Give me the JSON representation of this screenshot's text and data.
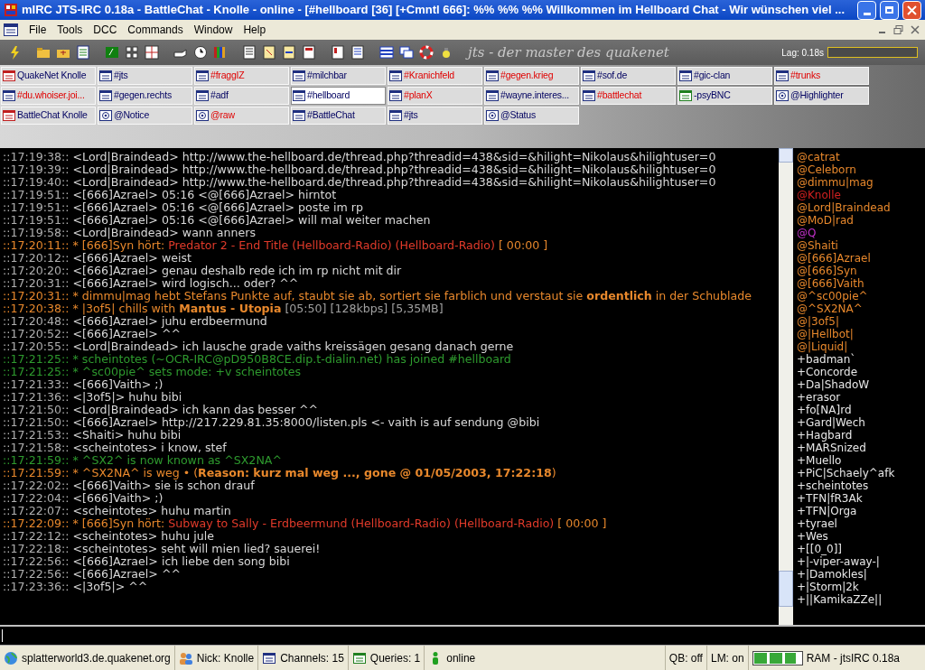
{
  "window": {
    "title": "mIRC JTS-IRC 0.18a - BattleChat - Knolle - online - [#hellboard [36] [+Cmntl 666]: %% %% %%  Willkommen im Hellboard Chat - Wir wünschen viel ..."
  },
  "menu": [
    "File",
    "Tools",
    "DCC",
    "Commands",
    "Window",
    "Help"
  ],
  "toolbar": {
    "logo": "jts - der master des quakenet",
    "lag": "Lag: 0.18s",
    "lag_meter": {
      "level": 0
    }
  },
  "switchbar": [
    [
      {
        "label": "QuakeNet Knolle",
        "kind": "status",
        "activity": false,
        "selected": false
      },
      {
        "label": "#jts",
        "kind": "channel",
        "activity": false,
        "selected": false
      },
      {
        "label": "#fraggIZ",
        "kind": "channel",
        "activity": true,
        "selected": false
      },
      {
        "label": "#milchbar",
        "kind": "channel",
        "activity": false,
        "selected": false
      },
      {
        "label": "#Kranichfeld",
        "kind": "channel",
        "activity": true,
        "selected": false
      },
      {
        "label": "#gegen.krieg",
        "kind": "channel",
        "activity": true,
        "selected": false
      },
      {
        "label": "#sof.de",
        "kind": "channel",
        "activity": false,
        "selected": false
      },
      {
        "label": "#gic-clan",
        "kind": "channel",
        "activity": false,
        "selected": false
      },
      {
        "label": "#trunks",
        "kind": "channel",
        "activity": true,
        "selected": false
      }
    ],
    [
      {
        "label": "#du.whoiser.joi...",
        "kind": "channel",
        "activity": true,
        "selected": false
      },
      {
        "label": "#gegen.rechts",
        "kind": "channel",
        "activity": false,
        "selected": false
      },
      {
        "label": "#adf",
        "kind": "channel",
        "activity": false,
        "selected": false
      },
      {
        "label": "#hellboard",
        "kind": "channel",
        "activity": false,
        "selected": true
      },
      {
        "label": "#planX",
        "kind": "channel",
        "activity": true,
        "selected": false
      },
      {
        "label": "#wayne.interes...",
        "kind": "channel",
        "activity": false,
        "selected": false
      },
      {
        "label": "#battlechat",
        "kind": "channel",
        "activity": true,
        "selected": false
      },
      {
        "label": "-psyBNC",
        "kind": "query",
        "activity": false,
        "selected": false
      },
      {
        "label": "@Highlighter",
        "kind": "custom",
        "activity": false,
        "selected": false
      }
    ],
    [
      {
        "label": "BattleChat Knolle",
        "kind": "status",
        "activity": false,
        "selected": false
      },
      {
        "label": "@Notice",
        "kind": "custom",
        "activity": false,
        "selected": false
      },
      {
        "label": "@raw",
        "kind": "custom",
        "activity": true,
        "selected": false
      },
      {
        "label": "#BattleChat",
        "kind": "channel",
        "activity": false,
        "selected": false
      },
      {
        "label": "#jts",
        "kind": "channel",
        "activity": false,
        "selected": false
      },
      {
        "label": "@Status",
        "kind": "custom",
        "activity": false,
        "selected": false
      }
    ]
  ],
  "chat": [
    {
      "kind": "msg",
      "time": "::17:19:38::",
      "nick": "<Lord|Braindead>",
      "text": "http://www.the-hellboard.de/thread.php?threadid=438&sid=&hilight=Nikolaus&hilightuser=0"
    },
    {
      "kind": "msg",
      "time": "::17:19:39::",
      "nick": "<Lord|Braindead>",
      "text": "http://www.the-hellboard.de/thread.php?threadid=438&sid=&hilight=Nikolaus&hilightuser=0"
    },
    {
      "kind": "msg",
      "time": "::17:19:40::",
      "nick": "<Lord|Braindead>",
      "text": "http://www.the-hellboard.de/thread.php?threadid=438&sid=&hilight=Nikolaus&hilightuser=0"
    },
    {
      "kind": "msg",
      "time": "::17:19:51::",
      "nick": "<[666]Azrael>",
      "text": "05:16 <@[666]Azrael> hirntot"
    },
    {
      "kind": "msg",
      "time": "::17:19:51::",
      "nick": "<[666]Azrael>",
      "text": "05:16 <@[666]Azrael> poste im rp"
    },
    {
      "kind": "msg",
      "time": "::17:19:51::",
      "nick": "<[666]Azrael>",
      "text": "05:16 <@[666]Azrael> will mal weiter machen"
    },
    {
      "kind": "msg",
      "time": "::17:19:58::",
      "nick": "<Lord|Braindead>",
      "text": "wann anners"
    },
    {
      "kind": "event",
      "time": "::17:20:11::",
      "parts": [
        {
          "text": "* [666]Syn hört: ",
          "color": "#e8882c"
        },
        {
          "text": "Predator 2 - End Title (Hellboard-Radio) (Hellboard-Radio)",
          "color": "#e03a2a"
        },
        {
          "text": "[ 00:00 ]",
          "color": "#e8882c"
        }
      ]
    },
    {
      "kind": "msg",
      "time": "::17:20:12::",
      "nick": "<[666]Azrael>",
      "text": "weist"
    },
    {
      "kind": "msg",
      "time": "::17:20:20::",
      "nick": "<[666]Azrael>",
      "text": "genau deshalb rede ich im rp nicht mit dir"
    },
    {
      "kind": "msg",
      "time": "::17:20:31::",
      "nick": "<[666]Azrael>",
      "text": "wird logisch... oder? ^^"
    },
    {
      "kind": "event",
      "time": "::17:20:31::",
      "parts": [
        {
          "text": "* dimmu|mag hebt Stefans Punkte auf, staubt sie ab, sortiert sie farblich und verstaut sie **ordentlich** in der Schublade",
          "color": "#e8882c"
        }
      ]
    },
    {
      "kind": "event",
      "time": "::17:20:38::",
      "parts": [
        {
          "text": "* |3of5| chills with **Mantus - Utopia**",
          "color": "#e8882c"
        },
        {
          "text": "[05:50] [128kbps] [5,35MB]",
          "color": "#a0a0a0"
        }
      ]
    },
    {
      "kind": "msg",
      "time": "::17:20:48::",
      "nick": "<[666]Azrael>",
      "text": "juhu erdbeermund"
    },
    {
      "kind": "msg",
      "time": "::17:20:52::",
      "nick": "<[666]Azrael>",
      "text": "^^"
    },
    {
      "kind": "msg",
      "time": "::17:20:55::",
      "nick": "<Lord|Braindead>",
      "text": "ich lausche grade vaiths kreissägen gesang danach gerne"
    },
    {
      "kind": "event",
      "time": "::17:21:25::",
      "parts": [
        {
          "text": "* scheintotes (~OCR-IRC@pD950B8CE.dip.t-dialin.net) has joined #hellboard",
          "color": "#2e9a2e"
        }
      ]
    },
    {
      "kind": "event",
      "time": "::17:21:25::",
      "parts": [
        {
          "text": "* ^sc00pie^ sets mode: +v scheintotes",
          "color": "#2e9a2e"
        }
      ]
    },
    {
      "kind": "msg",
      "time": "::17:21:33::",
      "nick": "<[666]Vaith>",
      "text": ";)"
    },
    {
      "kind": "msg",
      "time": "::17:21:36::",
      "nick": "<|3of5|>",
      "text": "huhu bibi"
    },
    {
      "kind": "msg",
      "time": "::17:21:50::",
      "nick": "<Lord|Braindead>",
      "text": "ich kann das besser ^^"
    },
    {
      "kind": "msg",
      "time": "::17:21:50::",
      "nick": "<[666]Azrael>",
      "text": "http://217.229.81.35:8000/listen.pls <- vaith is auf sendung @bibi"
    },
    {
      "kind": "msg",
      "time": "::17:21:53::",
      "nick": "<Shaiti>",
      "text": "huhu bibi"
    },
    {
      "kind": "msg",
      "time": "::17:21:58::",
      "nick": "<scheintotes>",
      "text": "i know, stef"
    },
    {
      "kind": "event",
      "time": "::17:21:59::",
      "parts": [
        {
          "text": "* ^SX2^ is now known as ^SX2NA^",
          "color": "#2e9a2e"
        }
      ]
    },
    {
      "kind": "event",
      "time": "::17:21:59::",
      "parts": [
        {
          "text": "* ^SX2NA^ is weg • (**Reason: kurz mal weg ..., gone @ 01/05/2003, 17:22:18**)",
          "color": "#e8882c"
        }
      ]
    },
    {
      "kind": "msg",
      "time": "::17:22:02::",
      "nick": "<[666]Vaith>",
      "text": "sie is schon drauf"
    },
    {
      "kind": "msg",
      "time": "::17:22:04::",
      "nick": "<[666]Vaith>",
      "text": ";)"
    },
    {
      "kind": "msg",
      "time": "::17:22:07::",
      "nick": "<scheintotes>",
      "text": "huhu martin"
    },
    {
      "kind": "event",
      "time": "::17:22:09::",
      "parts": [
        {
          "text": "* [666]Syn hört: ",
          "color": "#e8882c"
        },
        {
          "text": "Subway to Sally - Erdbeermund (Hellboard-Radio) (Hellboard-Radio)",
          "color": "#e03a2a"
        },
        {
          "text": "[ 00:00 ]",
          "color": "#e8882c"
        }
      ]
    },
    {
      "kind": "msg",
      "time": "::17:22:12::",
      "nick": "<scheintotes>",
      "text": "huhu jule"
    },
    {
      "kind": "msg",
      "time": "::17:22:18::",
      "nick": "<scheintotes>",
      "text": "seht will mien lied? sauerei!"
    },
    {
      "kind": "msg",
      "time": "::17:22:56::",
      "nick": "<[666]Azrael>",
      "text": "ich liebe den song bibi"
    },
    {
      "kind": "msg",
      "time": "::17:22:56::",
      "nick": "<[666]Azrael>",
      "text": "^^"
    },
    {
      "kind": "msg",
      "time": "::17:23:36::",
      "nick": "<|3of5|>",
      "text": "^^"
    }
  ],
  "nicklist": [
    {
      "nick": "@catrat",
      "color": "#e8882c"
    },
    {
      "nick": "@Celeborn",
      "color": "#e8882c"
    },
    {
      "nick": "@dimmu|mag",
      "color": "#e8882c"
    },
    {
      "nick": "@Knolle",
      "color": "#d02020"
    },
    {
      "nick": "@Lord|Braindead",
      "color": "#e8882c"
    },
    {
      "nick": "@MoD|rad",
      "color": "#e8882c"
    },
    {
      "nick": "@Q",
      "color": "#c030c8"
    },
    {
      "nick": "@Shaiti",
      "color": "#e8882c"
    },
    {
      "nick": "@[666]Azrael",
      "color": "#e8882c"
    },
    {
      "nick": "@[666]Syn",
      "color": "#e8882c"
    },
    {
      "nick": "@[666]Vaith",
      "color": "#e8882c"
    },
    {
      "nick": "@^sc00pie^",
      "color": "#e8882c"
    },
    {
      "nick": "@^SX2NA^",
      "color": "#e8882c"
    },
    {
      "nick": "@|3of5|",
      "color": "#e8882c"
    },
    {
      "nick": "@|Hellbot|",
      "color": "#e8882c"
    },
    {
      "nick": "@|Liquid|",
      "color": "#e8882c"
    },
    {
      "nick": "+badman`",
      "color": "#e8e8e8"
    },
    {
      "nick": "+Concorde",
      "color": "#e8e8e8"
    },
    {
      "nick": "+Da|ShadoW",
      "color": "#e8e8e8"
    },
    {
      "nick": "+erasor",
      "color": "#e8e8e8"
    },
    {
      "nick": "+fo[NA]rd",
      "color": "#e8e8e8"
    },
    {
      "nick": "+Gard|Wech",
      "color": "#e8e8e8"
    },
    {
      "nick": "+Hagbard",
      "color": "#e8e8e8"
    },
    {
      "nick": "+MARSnized",
      "color": "#e8e8e8"
    },
    {
      "nick": "+Muello",
      "color": "#e8e8e8"
    },
    {
      "nick": "+PiC|Schaely^afk",
      "color": "#e8e8e8"
    },
    {
      "nick": "+scheintotes",
      "color": "#e8e8e8"
    },
    {
      "nick": "+TFN|fR3Ak",
      "color": "#e8e8e8"
    },
    {
      "nick": "+TFN|Orga",
      "color": "#e8e8e8"
    },
    {
      "nick": "+tyrael",
      "color": "#e8e8e8"
    },
    {
      "nick": "+Wes",
      "color": "#e8e8e8"
    },
    {
      "nick": "+[[0_0]]",
      "color": "#e8e8e8"
    },
    {
      "nick": "+|-viper-away-|",
      "color": "#e8e8e8"
    },
    {
      "nick": "+|Damokles|",
      "color": "#e8e8e8"
    },
    {
      "nick": "+|Storm|2k",
      "color": "#e8e8e8"
    },
    {
      "nick": "+||KamikaZZe||",
      "color": "#e8e8e8"
    }
  ],
  "status_bar": {
    "server": "splatterworld3.de.quakenet.org",
    "nick": "Nick: Knolle",
    "channels": "Channels: 15",
    "queries": "Queries: 1",
    "state": "online",
    "qb": "QB: off",
    "lm": "LM: on",
    "ram_meter": {
      "level": 0.9
    },
    "ram": "RAM - jtsIRC 0.18a"
  }
}
